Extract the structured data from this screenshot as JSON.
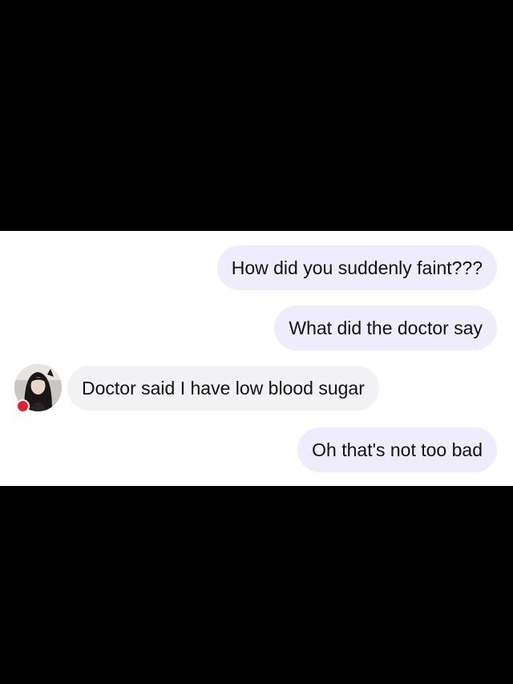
{
  "conversation": {
    "messages": [
      {
        "direction": "outgoing",
        "text": "How did you suddenly faint???"
      },
      {
        "direction": "outgoing",
        "text": "What did the doctor say"
      },
      {
        "direction": "incoming",
        "text": "Doctor said I have low blood sugar"
      },
      {
        "direction": "outgoing",
        "text": "Oh that's not too bad"
      }
    ],
    "contact": {
      "avatar": "contact-avatar-photo",
      "status": "unread-indicator"
    }
  },
  "colors": {
    "outgoing_bubble": "#efedfb",
    "incoming_bubble": "#f2f2f4",
    "status_dot": "#e0202e",
    "letterbox": "#000000"
  }
}
